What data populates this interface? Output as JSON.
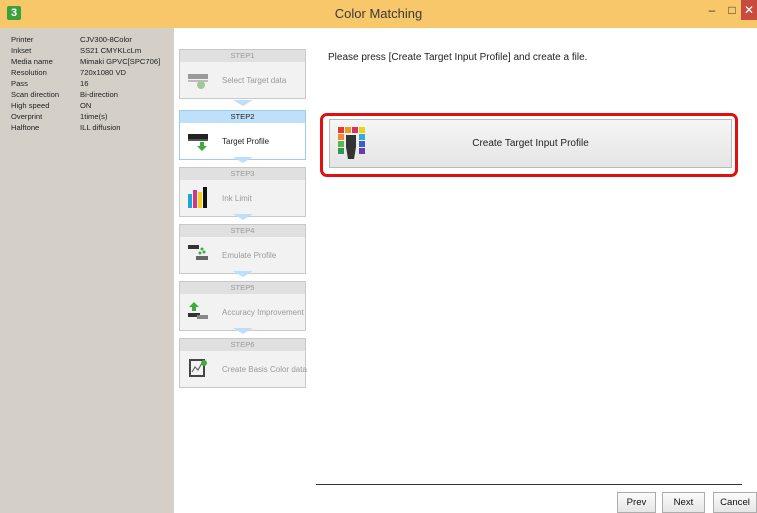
{
  "window": {
    "title": "Color Matching",
    "app_icon": "3",
    "minimize": "–",
    "maximize": "□",
    "close": "✕"
  },
  "printer_info": [
    {
      "label": "Printer",
      "value": "CJV300-8Color"
    },
    {
      "label": "Inkset",
      "value": "SS21 CMYKLcLm"
    },
    {
      "label": "Media name",
      "value": "Mimaki GPVC[SPC706]"
    },
    {
      "label": "Resolution",
      "value": "720x1080 VD"
    },
    {
      "label": "Pass",
      "value": "16"
    },
    {
      "label": "Scan direction",
      "value": "Bi-direction"
    },
    {
      "label": "High speed",
      "value": "ON"
    },
    {
      "label": "Overprint",
      "value": "1time(s)"
    },
    {
      "label": "Halftone",
      "value": "ILL diffusion"
    }
  ],
  "steps": [
    {
      "head": "STEP1",
      "label": "Select Target data",
      "icon": "printer-icon",
      "active": false
    },
    {
      "head": "STEP2",
      "label": "Target Profile",
      "icon": "printer-download-icon",
      "active": true
    },
    {
      "head": "STEP3",
      "label": "Ink Limit",
      "icon": "ink-bars-icon",
      "active": false
    },
    {
      "head": "STEP4",
      "label": "Emulate Profile",
      "icon": "emulate-printer-icon",
      "active": false
    },
    {
      "head": "STEP5",
      "label": "Accuracy Improvement",
      "icon": "upload-printer-icon",
      "active": false
    },
    {
      "head": "STEP6",
      "label": "Create Basis Color data",
      "icon": "chart-document-icon",
      "active": false
    }
  ],
  "main": {
    "instruction": "Please press [Create Target Input Profile] and create a file.",
    "create_button": "Create Target Input Profile",
    "create_icon": "color-patch-profile-icon"
  },
  "buttons": {
    "prev": "Prev",
    "next": "Next",
    "cancel": "Cancel"
  },
  "colors": {
    "titlebar": "#f7c76a",
    "left_pane": "#d4d0c8",
    "active_step": "#bfe0fa",
    "highlight": "#e01010"
  }
}
